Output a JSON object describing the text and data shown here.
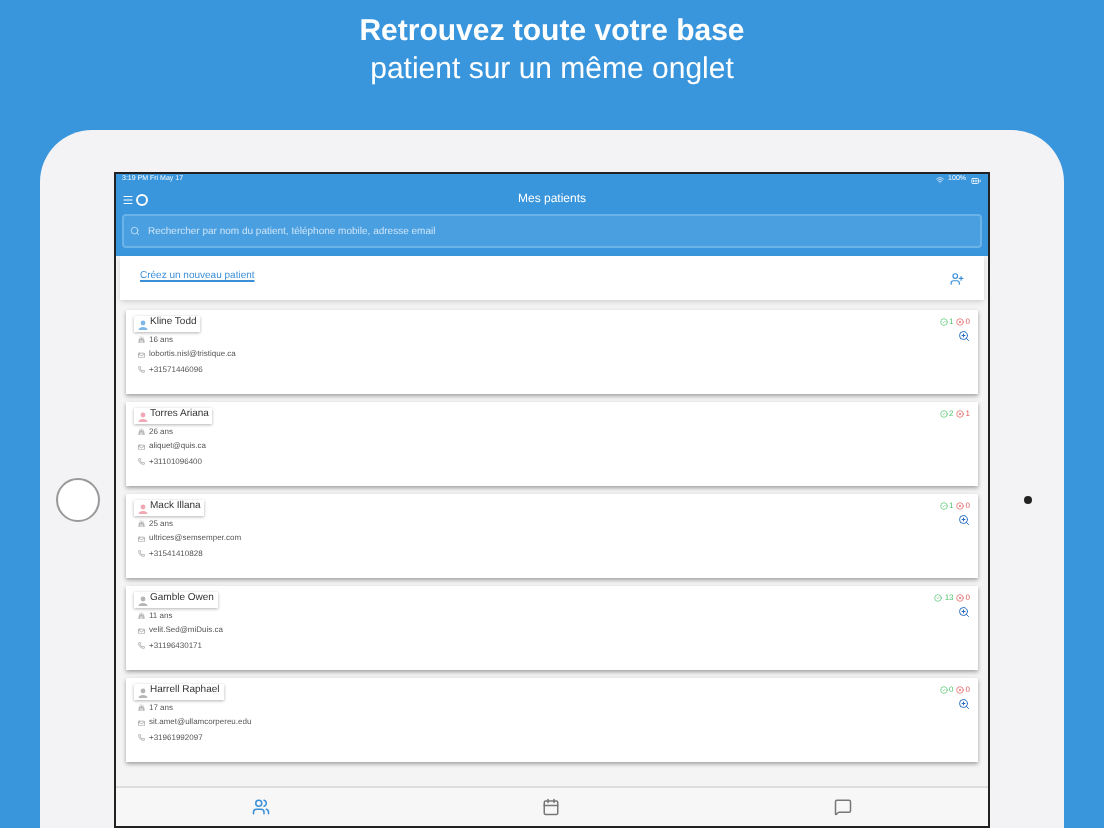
{
  "headline": {
    "bold": "Retrouvez toute votre base",
    "regular": "patient sur un même onglet"
  },
  "status_bar": {
    "time": "3:19 PM  Fri May 17",
    "battery": "100%"
  },
  "nav": {
    "title": "Mes patients"
  },
  "search": {
    "placeholder": "Rechercher par nom du patient, téléphone mobile, adresse email"
  },
  "create_link": "Créez un nouveau patient",
  "patients": [
    {
      "name": "Kline Todd",
      "color": "#7fb6e8",
      "age": "16 ans",
      "email": "lobortis.nisl@tristique.ca",
      "phone": "+31571446096",
      "ok": "1",
      "ko": "0",
      "zoom": true
    },
    {
      "name": "Torres Ariana",
      "color": "#f2a7b4",
      "age": "26 ans",
      "email": "aliquet@quis.ca",
      "phone": "+31101096400",
      "ok": "2",
      "ko": "1",
      "zoom": false
    },
    {
      "name": "Mack Illana",
      "color": "#f2a7b4",
      "age": "25 ans",
      "email": "ultrices@semsemper.com",
      "phone": "+31541410828",
      "ok": "1",
      "ko": "0",
      "zoom": true
    },
    {
      "name": "Gamble Owen",
      "color": "#b5b5b5",
      "age": "11 ans",
      "email": "velit.Sed@miDuis.ca",
      "phone": "+31196430171",
      "ok": "13",
      "ko": "0",
      "zoom": true
    },
    {
      "name": "Harrell Raphael",
      "color": "#b5b5b5",
      "age": "17 ans",
      "email": "sit.amet@ullamcorpereu.edu",
      "phone": "+31961992097",
      "ok": "0",
      "ko": "0",
      "zoom": true
    }
  ],
  "tabs": [
    {
      "kind": "people",
      "selected": true
    },
    {
      "kind": "calendar",
      "selected": false
    },
    {
      "kind": "chat",
      "selected": false
    }
  ]
}
